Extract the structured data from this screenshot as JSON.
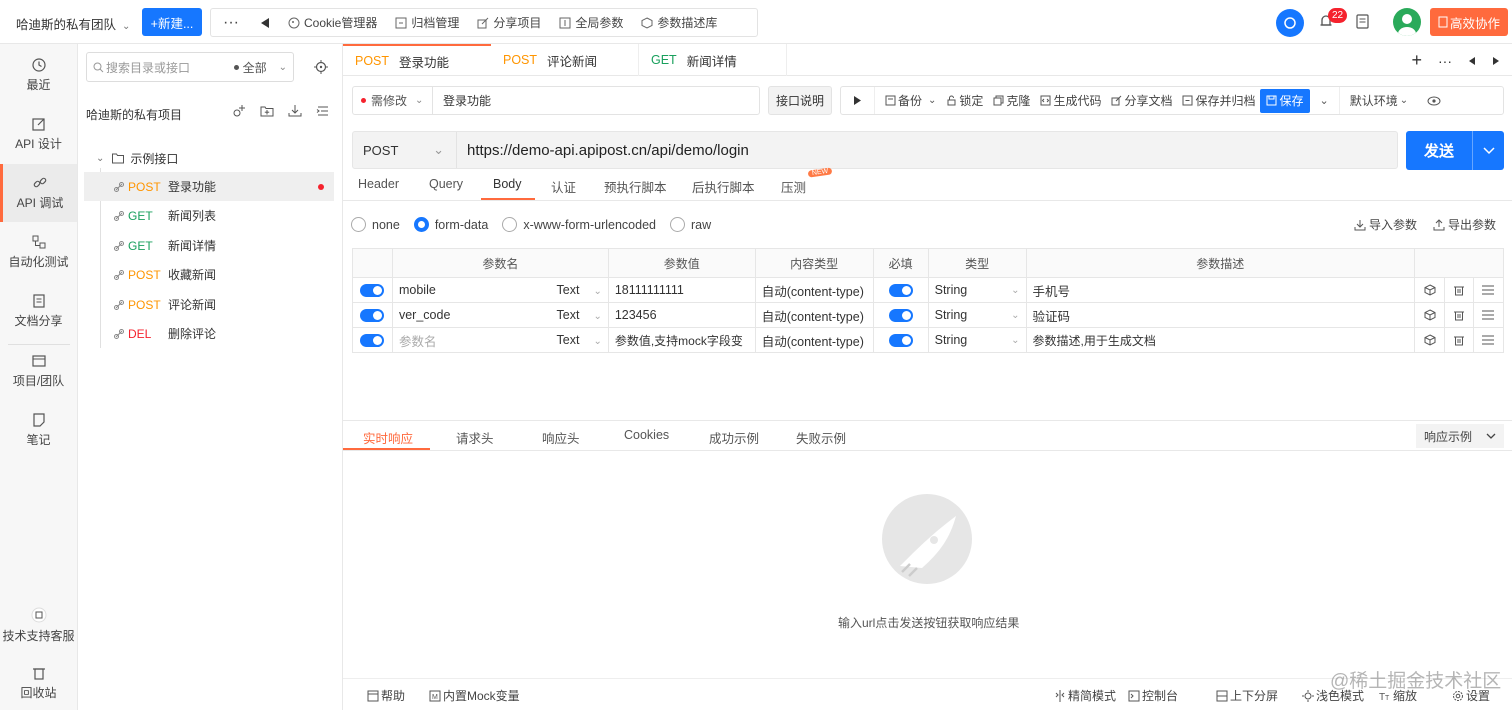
{
  "topbar": {
    "team_name": "哈迪斯的私有团队",
    "new_button": "+新建...",
    "more": "···",
    "tools": [
      {
        "label": "Cookie管理器",
        "icon": "cookie-icon"
      },
      {
        "label": "归档管理",
        "icon": "archive-icon"
      },
      {
        "label": "分享项目",
        "icon": "share-icon"
      },
      {
        "label": "全局参数",
        "icon": "params-icon"
      },
      {
        "label": "参数描述库",
        "icon": "cube-icon"
      }
    ],
    "notification_count": "22",
    "collab_button": "高效协作",
    "accent": "#ff6a3d",
    "primary": "#1677ff"
  },
  "leftnav": {
    "items": [
      {
        "label": "最近",
        "icon": "clock-icon"
      },
      {
        "label": "API 设计",
        "icon": "edit-icon"
      },
      {
        "label": "API 调试",
        "icon": "link-icon"
      },
      {
        "label": "自动化测试",
        "icon": "flow-icon"
      },
      {
        "label": "文档分享",
        "icon": "doc-share-icon"
      },
      {
        "label": "项目/团队",
        "icon": "window-icon"
      },
      {
        "label": "笔记",
        "icon": "note-icon"
      },
      {
        "label": "技术支持客服",
        "icon": "support-icon"
      },
      {
        "label": "回收站",
        "icon": "trash-icon"
      }
    ]
  },
  "tree": {
    "search_placeholder": "搜索目录或接口",
    "filter": "全部",
    "project_name": "哈迪斯的私有项目",
    "folder": "示例接口",
    "items": [
      {
        "method": "POST",
        "name": "登录功能"
      },
      {
        "method": "GET",
        "name": "新闻列表"
      },
      {
        "method": "GET",
        "name": "新闻详情"
      },
      {
        "method": "POST",
        "name": "收藏新闻"
      },
      {
        "method": "POST",
        "name": "评论新闻"
      },
      {
        "method": "DEL",
        "name": "删除评论"
      }
    ]
  },
  "tabs": [
    {
      "method": "POST",
      "name": "登录功能"
    },
    {
      "method": "POST",
      "name": "评论新闻"
    },
    {
      "method": "GET",
      "name": "新闻详情"
    }
  ],
  "request": {
    "status": "需修改",
    "name": "登录功能",
    "desc_button": "接口说明",
    "actions": {
      "backup": "备份",
      "lock": "锁定",
      "clone": "克隆",
      "gencode": "生成代码",
      "sharedoc": "分享文档",
      "save_archive": "保存并归档",
      "save": "保存",
      "env": "默认环境"
    },
    "method": "POST",
    "url": "https://demo-api.apipost.cn/api/demo/login",
    "send": "发送",
    "req_tabs": [
      "Header",
      "Query",
      "Body",
      "认证",
      "预执行脚本",
      "后执行脚本",
      "压测"
    ],
    "new_tag": "NEW",
    "body_types": [
      "none",
      "form-data",
      "x-www-form-urlencoded",
      "raw"
    ],
    "import_params": "导入参数",
    "export_params": "导出参数"
  },
  "params": {
    "headers": [
      "参数名",
      "参数值",
      "内容类型",
      "必填",
      "类型",
      "参数描述"
    ],
    "rows": [
      {
        "name": "mobile",
        "kind": "Text",
        "value": "18111111111",
        "content_type": "自动(content-type)",
        "type": "String",
        "desc": "手机号",
        "placeholder": false
      },
      {
        "name": "ver_code",
        "kind": "Text",
        "value": "123456",
        "content_type": "自动(content-type)",
        "type": "String",
        "desc": "验证码",
        "placeholder": false
      },
      {
        "name": "参数名",
        "kind": "Text",
        "value": "参数值,支持mock字段变",
        "content_type": "自动(content-type)",
        "type": "String",
        "desc": "参数描述,用于生成文档",
        "placeholder": true
      }
    ]
  },
  "response": {
    "tabs": [
      "实时响应",
      "请求头",
      "响应头",
      "Cookies",
      "成功示例",
      "失败示例"
    ],
    "example_button": "响应示例",
    "empty_message": "输入url点击发送按钮获取响应结果"
  },
  "bottombar": {
    "help": "帮助",
    "mock": "内置Mock变量",
    "simple": "精简模式",
    "console": "控制台",
    "split": "上下分屏",
    "theme": "浅色模式",
    "zoom": "缩放",
    "settings": "设置"
  },
  "watermark": "@稀土掘金技术社区"
}
